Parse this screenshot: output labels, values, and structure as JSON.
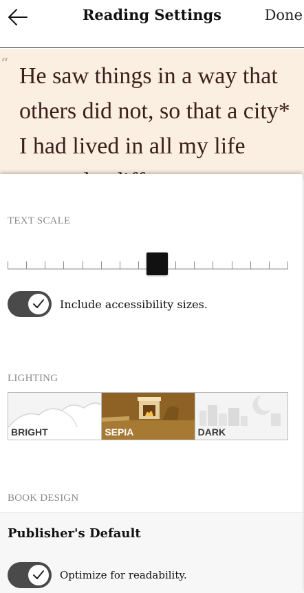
{
  "header": {
    "title": "Reading Settings",
    "done_label": "Done",
    "back_icon": "arrow-left-icon"
  },
  "preview": {
    "quote_mark": "“",
    "text": "He saw things in a way that others did not, so that a city* I had lived in all my life seemed a different"
  },
  "text_scale": {
    "label": "TEXT SCALE",
    "steps": 16,
    "selected_step": 8
  },
  "accessibility_toggle": {
    "label": "Include accessibility sizes.",
    "on": true
  },
  "lighting": {
    "label": "LIGHTING",
    "options": [
      {
        "label": "BRIGHT",
        "selected": false
      },
      {
        "label": "SEPIA",
        "selected": true
      },
      {
        "label": "DARK",
        "selected": false
      }
    ]
  },
  "book_design": {
    "label": "BOOK DESIGN",
    "selected_design": "Publisher's Default",
    "readability_toggle": {
      "label": "Optimize for readability.",
      "on": true
    }
  },
  "colors": {
    "preview_background": "#fbefe2",
    "preview_text": "#3b1f1a",
    "toggle_track": "#4a4a4a",
    "sepia": "#9b6f2c"
  }
}
